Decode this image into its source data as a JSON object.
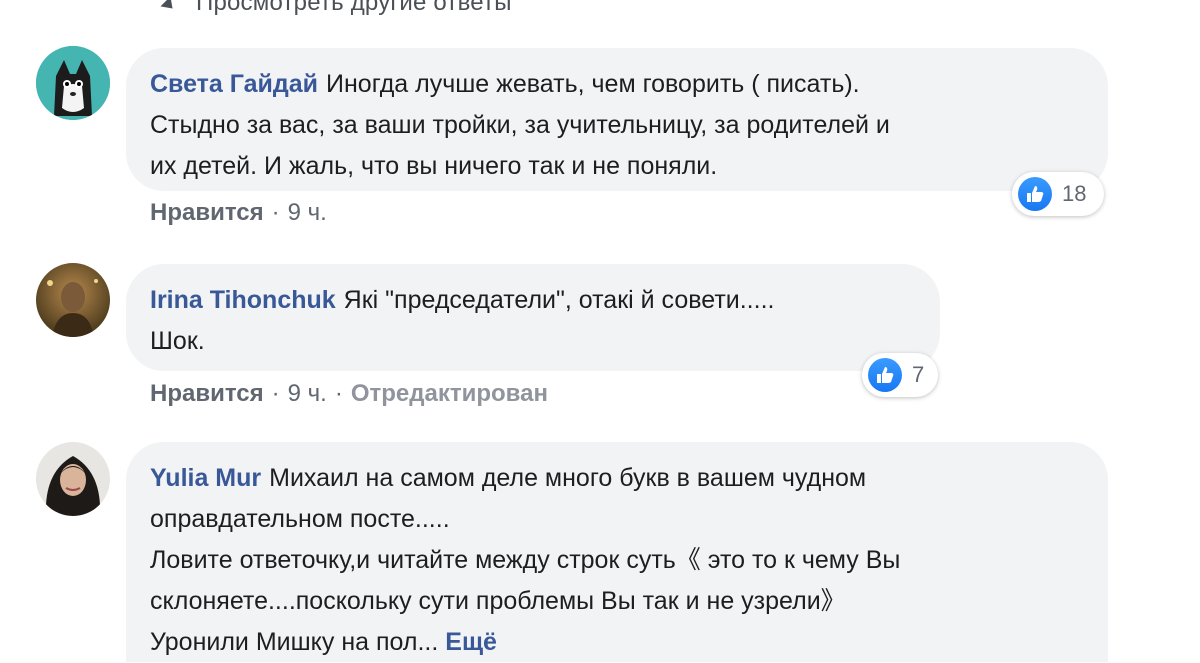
{
  "top_link": {
    "label": "Просмотреть другие ответы"
  },
  "comments": [
    {
      "author": "Света Гайдай",
      "lines": [
        "Иногда лучше жевать, чем говорить ( писать).",
        "Стыдно за вас, за ваши тройки, за учительницу, за родителей и",
        "их детей. И жаль, что вы ничего так и не поняли."
      ],
      "reactions": "18",
      "like_label": "Нравится",
      "time": "9 ч."
    },
    {
      "author": "Irina Tihonchuk",
      "lines": [
        "Які \"председатели\", отакі й совети.....",
        "Шок."
      ],
      "reactions": "7",
      "like_label": "Нравится",
      "time": "9 ч.",
      "edited": "Отредактирован"
    },
    {
      "author": "Yulia Mur",
      "lines": [
        "Михаил на самом деле много букв в вашем чудном",
        "оправдательном посте.....",
        "Ловите ответочку,и читайте между строк суть《 это то к чему Вы",
        "склоняете....поскольку сути проблемы Вы так и не узрели》",
        "Уронили Мишку на пол..."
      ],
      "more": "Ещё"
    }
  ],
  "colors": {
    "author": "#385898",
    "bubble": "#f2f3f5",
    "like_blue": "#1877f2"
  }
}
